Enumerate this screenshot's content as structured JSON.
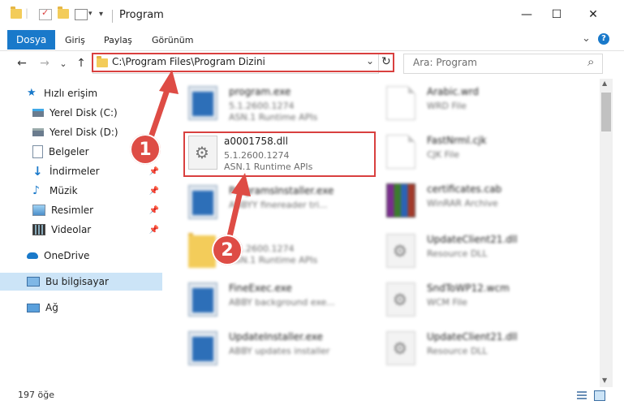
{
  "titlebar": {
    "title": "Program",
    "icons": [
      "folder-icon",
      "properties-check-icon",
      "new-folder-icon",
      "view-options-icon",
      "customize-qa-icon"
    ],
    "minimize": "—",
    "maximize": "☐",
    "close": "✕"
  },
  "ribbon": {
    "tabs": [
      "Dosya",
      "Giriş",
      "Paylaş",
      "Görünüm"
    ],
    "expand": "⌄",
    "help": "?"
  },
  "nav": {
    "back": "←",
    "forward": "→",
    "recent": "⌄",
    "up": "↑",
    "address": "C:\\Program Files\\Program Dizini",
    "dropdown": "⌄",
    "refresh": "↻",
    "search_placeholder": "Ara: Program",
    "search_icon": "⌕"
  },
  "sidebar": {
    "items": [
      {
        "label": "Hızlı erişim",
        "icon": "star-icon",
        "pinned": false
      },
      {
        "label": "Yerel Disk (C:)",
        "icon": "drive-icon",
        "pinned": false
      },
      {
        "label": "Yerel Disk (D:)",
        "icon": "drive-icon",
        "pinned": false
      },
      {
        "label": "Belgeler",
        "icon": "documents-icon",
        "pinned": true
      },
      {
        "label": "İndirmeler",
        "icon": "download-icon",
        "pinned": true
      },
      {
        "label": "Müzik",
        "icon": "music-icon",
        "pinned": true
      },
      {
        "label": "Resimler",
        "icon": "pictures-icon",
        "pinned": true
      },
      {
        "label": "Videolar",
        "icon": "video-icon",
        "pinned": true
      },
      {
        "label": "OneDrive",
        "icon": "cloud-icon",
        "pinned": false
      },
      {
        "label": "Bu bilgisayar",
        "icon": "computer-icon",
        "pinned": false,
        "selected": true
      },
      {
        "label": "Ağ",
        "icon": "network-icon",
        "pinned": false
      }
    ],
    "pin_glyph": "📌"
  },
  "files": {
    "left": [
      {
        "name": "program.exe",
        "line1": "5.1.2600.1274",
        "line2": "ASN.1 Runtime APIs",
        "icon": "exe-icon"
      },
      {
        "name": "a0001758.dll",
        "line1": "5.1.2600.1274",
        "line2": "ASN.1 Runtime APIs",
        "icon": "dll-gear-icon"
      },
      {
        "name": "ProgramsInstaller.exe",
        "line1": "ABBYY finereader tri...",
        "line2": "",
        "icon": "installer-icon"
      },
      {
        "name": "",
        "line1": "5.1.2600.1274",
        "line2": "ASN.1 Runtime APIs",
        "icon": "folder-icon"
      },
      {
        "name": "FineExec.exe",
        "line1": "ABBY background exe...",
        "line2": "",
        "icon": "exe-icon"
      },
      {
        "name": "UpdateInstaller.exe",
        "line1": "ABBY updates installer",
        "line2": "",
        "icon": "exe-icon"
      }
    ],
    "right": [
      {
        "name": "Arabic.wrd",
        "line1": "WRD File",
        "icon": "document-icon"
      },
      {
        "name": "FastNrml.cjk",
        "line1": "CJK File",
        "icon": "document-icon"
      },
      {
        "name": "certificates.cab",
        "line1": "WinRAR Archive",
        "icon": "winrar-icon"
      },
      {
        "name": "UpdateClient21.dll",
        "line1": "Resource DLL",
        "icon": "dll-gear-icon"
      },
      {
        "name": "SndToWP12.wcm",
        "line1": "WCM File",
        "icon": "dll-gear-icon"
      },
      {
        "name": "UpdateClient21.dll",
        "line1": "Resource DLL",
        "icon": "dll-gear-icon"
      }
    ]
  },
  "annotations": {
    "badge1": "1",
    "badge2": "2",
    "color": "#d9403f"
  },
  "status": {
    "count": "197 öğe"
  }
}
